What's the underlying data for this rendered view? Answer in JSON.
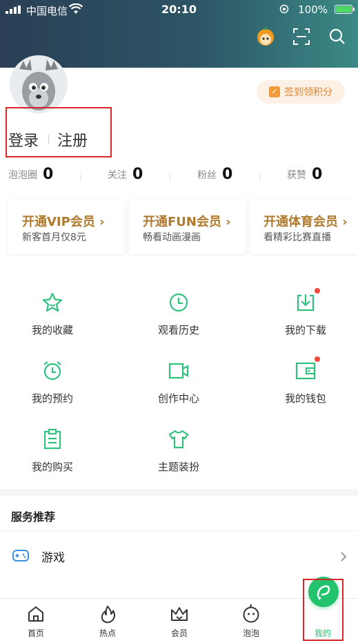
{
  "status_bar": {
    "carrier": "中国电信",
    "time": "20:10",
    "battery": "100%"
  },
  "profile": {
    "checkin_label": "签到领积分",
    "login": "登录",
    "register": "注册"
  },
  "stats": [
    {
      "label": "泡泡圈",
      "value": "0"
    },
    {
      "label": "关注",
      "value": "0"
    },
    {
      "label": "粉丝",
      "value": "0"
    },
    {
      "label": "获赞",
      "value": "0"
    }
  ],
  "vip_cards": [
    {
      "title": "开通VIP会员 ›",
      "subtitle": "新客首月仅8元"
    },
    {
      "title": "开通FUN会员 ›",
      "subtitle": "畅看动画漫画"
    },
    {
      "title": "开通体育会员 ›",
      "subtitle": "看精彩比赛直播"
    }
  ],
  "features": [
    {
      "label": "我的收藏",
      "icon": "star-icon"
    },
    {
      "label": "观看历史",
      "icon": "clock-icon"
    },
    {
      "label": "我的下载",
      "icon": "download-icon"
    },
    {
      "label": "我的预约",
      "icon": "alarm-icon"
    },
    {
      "label": "创作中心",
      "icon": "video-camera-icon"
    },
    {
      "label": "我的钱包",
      "icon": "wallet-icon"
    },
    {
      "label": "我的购买",
      "icon": "clipboard-icon"
    },
    {
      "label": "主题装扮",
      "icon": "tshirt-icon"
    }
  ],
  "services": {
    "title": "服务推荐",
    "items": [
      {
        "label": "游戏",
        "icon": "gamepad-icon"
      }
    ]
  },
  "tabbar": [
    {
      "label": "首页",
      "icon": "home-icon"
    },
    {
      "label": "热点",
      "icon": "flame-icon"
    },
    {
      "label": "会员",
      "icon": "crown-icon"
    },
    {
      "label": "泡泡",
      "icon": "bubble-face-icon"
    },
    {
      "label": "我的",
      "icon": "me-icon"
    }
  ],
  "colors": {
    "accent": "#22c36c",
    "vip_gold": "#b07a2e",
    "header_dark": "#2a3f55",
    "header_teal": "#3b8a86"
  }
}
